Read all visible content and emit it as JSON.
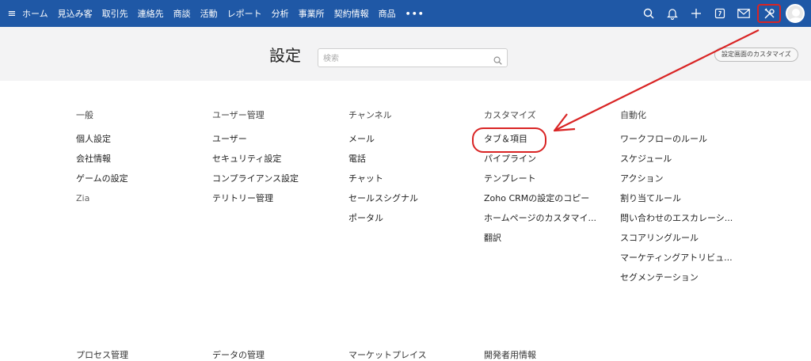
{
  "topbar": {
    "nav": [
      "ホーム",
      "見込み客",
      "取引先",
      "連絡先",
      "商談",
      "活動",
      "レポート",
      "分析",
      "事業所",
      "契約情報",
      "商品"
    ],
    "more": "•••",
    "icons": [
      "search-icon",
      "bell-icon",
      "plus-icon",
      "calendar-icon",
      "mail-icon",
      "setup-icon",
      "avatar"
    ]
  },
  "header": {
    "title": "設定",
    "search_placeholder": "検索",
    "customize_label": "設定画面のカスタマイズ"
  },
  "columns": [
    {
      "heading": "一般",
      "links": [
        "個人設定",
        "会社情報",
        "ゲームの設定",
        "Zia"
      ]
    },
    {
      "heading": "ユーザー管理",
      "links": [
        "ユーザー",
        "セキュリティ設定",
        "コンプライアンス設定",
        "テリトリー管理"
      ]
    },
    {
      "heading": "チャンネル",
      "links": [
        "メール",
        "電話",
        "チャット",
        "セールスシグナル",
        "ポータル"
      ]
    },
    {
      "heading": "カスタマイズ",
      "links": [
        "タブ＆項目",
        "パイプライン",
        "テンプレート",
        "Zoho CRMの設定のコピー",
        "ホームページのカスタマイ...",
        "翻訳"
      ]
    },
    {
      "heading": "自動化",
      "links": [
        "ワークフローのルール",
        "スケジュール",
        "アクション",
        "割り当てルール",
        "問い合わせのエスカレーシ...",
        "スコアリングルール",
        "マーケティングアトリビュ...",
        "セグメンテーション"
      ]
    }
  ],
  "bottom_headings": [
    "プロセス管理",
    "データの管理",
    "マーケットプレイス",
    "開発者用情報"
  ],
  "colors": {
    "topbar": "#1f58a6",
    "annotation": "#d92424",
    "header_bg": "#f3f3f4"
  }
}
